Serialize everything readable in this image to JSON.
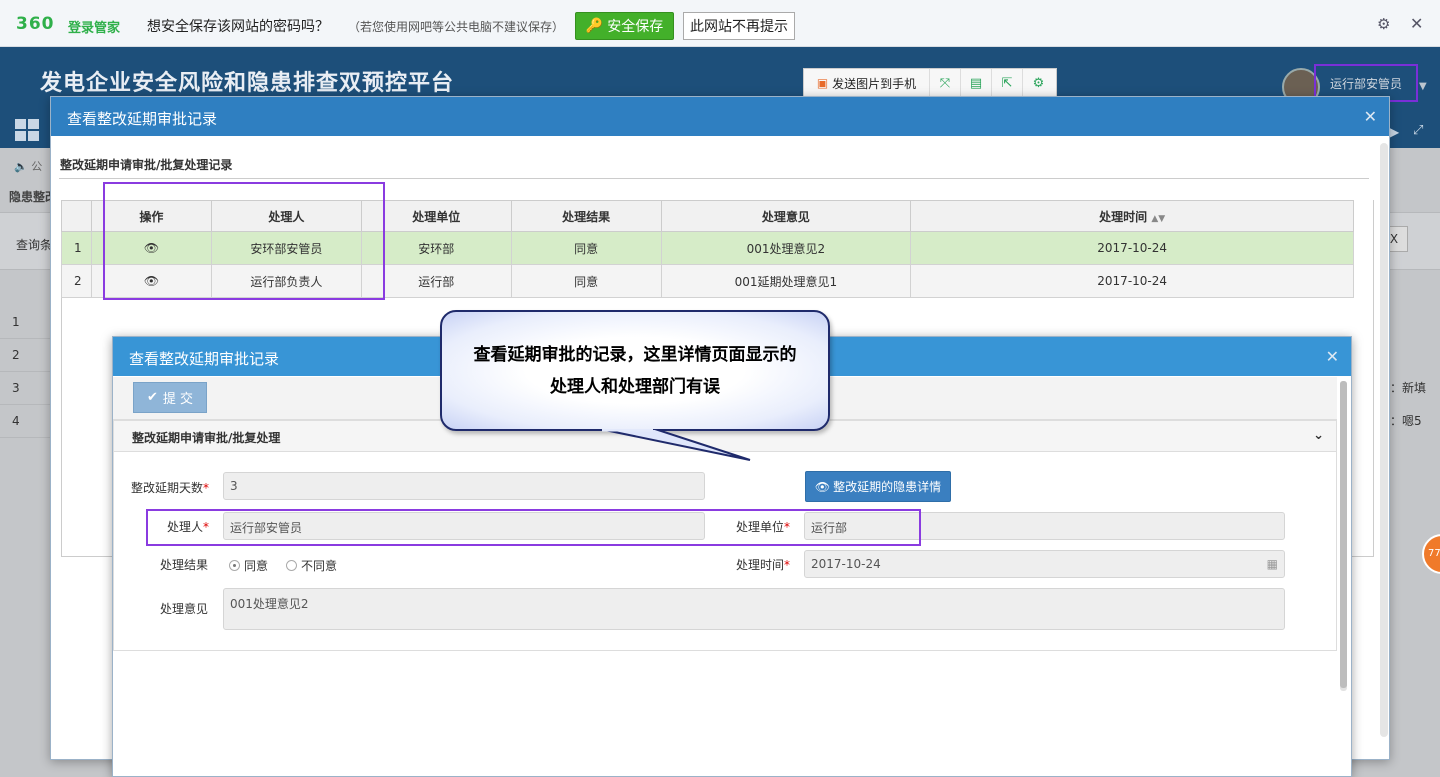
{
  "pwbar": {
    "logo": "360",
    "logo_sub": "登录管家",
    "message": "想安全保存该网站的密码吗？",
    "note": "（若您使用网吧等公共电脑不建议保存）",
    "save_label": "安全保存",
    "nomore_label": "此网站不再提示"
  },
  "app": {
    "title": "发电企业安全风险和隐患排查双预控平台",
    "user": "运行部安管员",
    "speaker_text": "公",
    "crumb": "隐患整改",
    "query_label": "查询条",
    "right_box": "X"
  },
  "toolbar2": {
    "send_label": "发送图片到手机"
  },
  "bg_rows_left": [
    "1",
    "2",
    "3",
    "4"
  ],
  "bg_rows_right": [
    "：新填",
    "：嗯5"
  ],
  "modal1": {
    "title": "查看整改延期审批记录",
    "section": "整改延期申请审批/批复处理记录",
    "columns": [
      "操作",
      "处理人",
      "处理单位",
      "处理结果",
      "处理意见",
      "处理时间"
    ],
    "rows": [
      {
        "num": "1",
        "handler": "安环部安管员",
        "unit": "安环部",
        "result": "同意",
        "opinion": "001处理意见2",
        "time": "2017-10-24"
      },
      {
        "num": "2",
        "handler": "运行部负责人",
        "unit": "运行部",
        "result": "同意",
        "opinion": "001延期处理意见1",
        "time": "2017-10-24"
      }
    ]
  },
  "modal2": {
    "title": "查看整改延期审批记录",
    "submit_label": "提 交",
    "panel_title": "整改延期申请审批/批复处理",
    "days_label": "整改延期天数",
    "days_value": "3",
    "detail_btn": "整改延期的隐患详情",
    "handler_label": "处理人",
    "handler_value": "运行部安管员",
    "unit_label": "处理单位",
    "unit_value": "运行部",
    "result_label": "处理结果",
    "result_options": [
      "同意",
      "不同意"
    ],
    "result_selected": "同意",
    "time_label": "处理时间",
    "time_value": "2017-10-24",
    "opinion_label": "处理意见",
    "opinion_value": "001处理意见2"
  },
  "callout": {
    "line1": "查看延期审批的记录，这里详情页面显示的",
    "line2": "处理人和处理部门有误"
  },
  "badge": "77"
}
